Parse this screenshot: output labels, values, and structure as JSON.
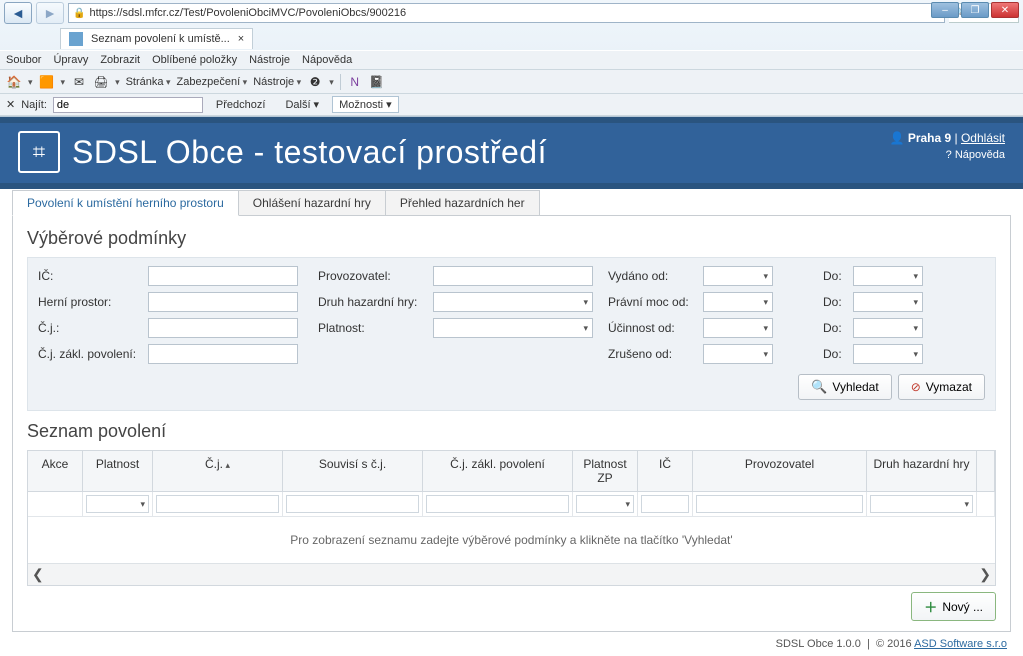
{
  "window_buttons": {
    "min": "–",
    "max": "❐",
    "close": "✕"
  },
  "browser": {
    "back": "◄",
    "fwd": "►",
    "url": "https://sdsl.mfcr.cz/Test/PovoleniObciMVC/PovoleniObcs/900216",
    "search_hint": "🔍 ▾",
    "tab_title": "Seznam povolení k umístě...",
    "tab_close": "×"
  },
  "menubar": [
    "Soubor",
    "Úpravy",
    "Zobrazit",
    "Oblíbené položky",
    "Nástroje",
    "Nápověda"
  ],
  "toolbar2": {
    "items": [
      "Stránka",
      "Zabezpečení",
      "Nástroje",
      "❷"
    ]
  },
  "findbar": {
    "label": "Najít:",
    "value": "de",
    "prev": "Předchozí",
    "next": "Další",
    "options": "Možnosti"
  },
  "header": {
    "title": "SDSL Obce - testovací prostředí",
    "user_icon": "👤",
    "user": "Praha 9",
    "logout": "Odhlásit",
    "help_icon": "?",
    "help": "Nápověda"
  },
  "tabs": {
    "t1": "Povolení k umístění herního prostoru",
    "t2": "Ohlášení hazardní hry",
    "t3": "Přehled hazardních her"
  },
  "filters": {
    "title": "Výběrové podmínky",
    "ic": "IČ:",
    "herni_prostor": "Herní prostor:",
    "cj": "Č.j.:",
    "cj_zakl": "Č.j. zákl. povolení:",
    "provozovatel": "Provozovatel:",
    "druh": "Druh hazardní hry:",
    "platnost": "Platnost:",
    "vydano": "Vydáno od:",
    "pravni_moc": "Právní moc od:",
    "ucinnost": "Účinnost od:",
    "zruseno": "Zrušeno od:",
    "do": "Do:",
    "btn_search": "Vyhledat",
    "btn_clear": "Vymazat"
  },
  "list": {
    "title": "Seznam povolení",
    "cols": {
      "akce": "Akce",
      "platnost": "Platnost",
      "cj": "Č.j.",
      "souvisi": "Souvisí s č.j.",
      "zakl": "Č.j. zákl. povolení",
      "platzp": "Platnost ZP",
      "ic": "IČ",
      "prov": "Provozovatel",
      "druh": "Druh hazardní hry"
    },
    "empty": "Pro zobrazení seznamu zadejte výběrové podmínky a klikněte na tlačítko 'Vyhledat'",
    "scroll_left": "❮",
    "scroll_right": "❯",
    "btn_new": "Nový ..."
  },
  "footer": {
    "version": "SDSL Obce 1.0.0",
    "sep": "|",
    "copy": "© 2016",
    "vendor": "ASD Software s.r.o"
  }
}
